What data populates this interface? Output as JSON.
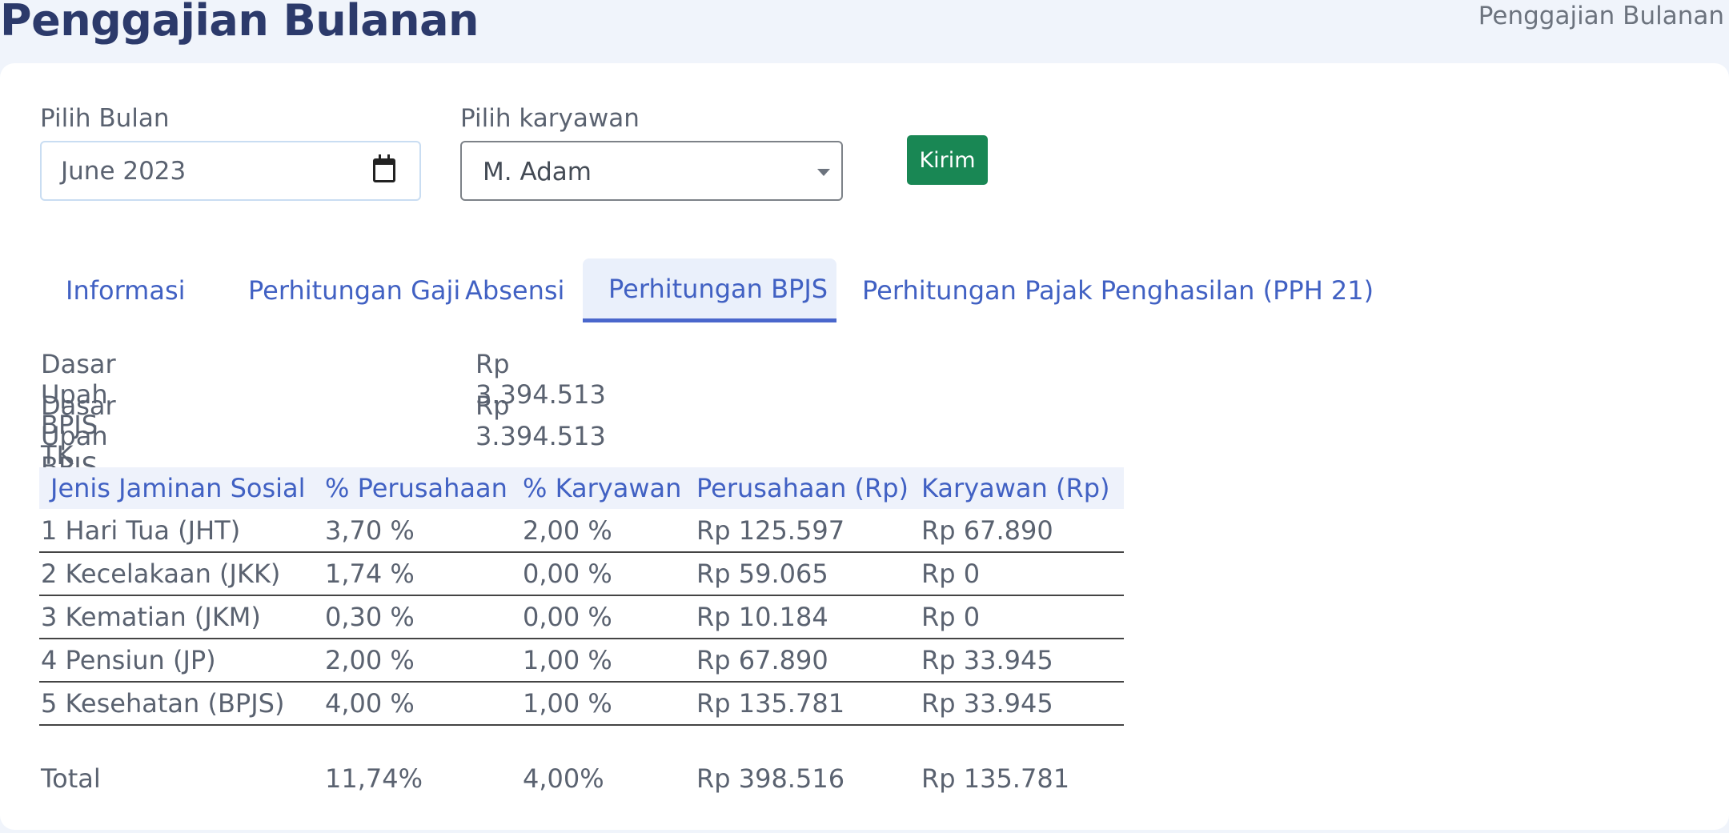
{
  "header": {
    "title": "Penggajian Bulanan",
    "breadcrumb": "Penggajian Bulanan"
  },
  "form": {
    "month_label": "Pilih Bulan",
    "month_value": "June 2023",
    "employee_label": "Pilih karyawan",
    "employee_value": "M. Adam",
    "submit_label": "Kirim"
  },
  "tabs": [
    {
      "label": "Informasi",
      "active": false
    },
    {
      "label": "Perhitungan Gaji",
      "active": false
    },
    {
      "label": "Absensi",
      "active": false
    },
    {
      "label": "Perhitungan BPJS",
      "active": true
    },
    {
      "label": "Perhitungan Pajak Penghasilan (PPH 21)",
      "active": false
    }
  ],
  "info": [
    {
      "label": "Dasar Upah BPJS TK",
      "value": "Rp 3.394.513"
    },
    {
      "label": "Dasar Upah BPJS KES",
      "value": "Rp 3.394.513"
    }
  ],
  "table": {
    "headers": [
      "Jenis Jaminan Sosial",
      "% Perusahaan",
      "% Karyawan",
      "Perusahaan (Rp)",
      "Karyawan (Rp)"
    ],
    "rows": [
      [
        "1 Hari Tua (JHT)",
        "3,70 %",
        "2,00 %",
        "Rp 125.597",
        "Rp 67.890"
      ],
      [
        "2 Kecelakaan (JKK)",
        "1,74 %",
        "0,00 %",
        "Rp 59.065",
        "Rp 0"
      ],
      [
        "3 Kematian (JKM)",
        "0,30 %",
        "0,00 %",
        "Rp 10.184",
        "Rp 0"
      ],
      [
        "4 Pensiun (JP)",
        "2,00 %",
        "1,00 %",
        "Rp 67.890",
        "Rp 33.945"
      ],
      [
        "5 Kesehatan (BPJS)",
        "4,00 %",
        "1,00 %",
        "Rp 135.781",
        "Rp 33.945"
      ]
    ],
    "total": [
      "Total",
      "11,74%",
      "4,00%",
      "Rp 398.516",
      "Rp 135.781"
    ]
  },
  "colors": {
    "title": "#2c3a6b",
    "accent": "#4161c3",
    "submit": "#198754",
    "page_bg": "#f0f4fb"
  },
  "icons": {
    "date_picker": "calendar-icon",
    "select": "chevron-down-icon"
  }
}
